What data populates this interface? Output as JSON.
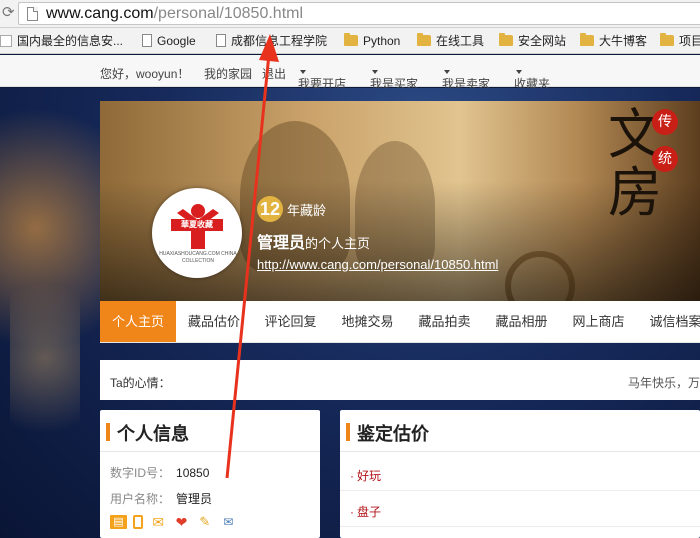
{
  "browser": {
    "url_host": "www.cang.com",
    "url_path": "/personal/10850.html",
    "reload_icon": "reload-icon",
    "bookmarks": [
      {
        "label": "国内最全的信息安...",
        "icon": "page-icon"
      },
      {
        "label": "Google",
        "icon": "page-icon"
      },
      {
        "label": "成都信息工程学院",
        "icon": "page-icon"
      },
      {
        "label": "Python",
        "icon": "folder-icon"
      },
      {
        "label": "在线工具",
        "icon": "folder-icon"
      },
      {
        "label": "安全网站",
        "icon": "folder-icon"
      },
      {
        "label": "大牛博客",
        "icon": "folder-icon"
      },
      {
        "label": "项目",
        "icon": "folder-icon"
      }
    ]
  },
  "topbar": {
    "greeting": "您好，wooyun！",
    "my_home": "我的家园",
    "logout": "退出",
    "open_shop": "我要开店",
    "buyer": "我是买家",
    "seller": "我是卖家",
    "favorites": "收藏夹"
  },
  "banner": {
    "calligraphy_1": "文",
    "calligraphy_2": "房",
    "seal_1": "传",
    "seal_2": "统",
    "years": "12",
    "years_label": "年藏龄",
    "owner_name": "管理员",
    "owner_suffix": "的个人主页",
    "homepage_link": "http://www.cang.com/personal/10850.html",
    "avatar_text": "華夏收藏",
    "avatar_ring_text": "HUAXIASHOUCANG.COM CHINA COLLECTION"
  },
  "nav": {
    "tabs": [
      "个人主页",
      "藏品估价",
      "评论回复",
      "地摊交易",
      "藏品拍卖",
      "藏品相册",
      "网上商店",
      "诚信档案"
    ],
    "active_index": 0
  },
  "mood": {
    "label": "Ta的心情：",
    "text": "马年快乐，万"
  },
  "info_panel": {
    "title": "个人信息",
    "id_label": "数字ID号：",
    "id_value": "10850",
    "user_label": "用户名称：",
    "user_value": "管理员",
    "badges": [
      "id-card-icon",
      "phone-icon",
      "mail-icon",
      "heart-icon",
      "pencil-icon",
      "certificate-icon"
    ]
  },
  "appraise_panel": {
    "title": "鉴定估价",
    "items": [
      "好玩",
      "盘子"
    ]
  },
  "colors": {
    "accent": "#f08519",
    "link_red": "#b1141b",
    "seal_red": "#c82016",
    "age_badge": "#e3b341"
  }
}
